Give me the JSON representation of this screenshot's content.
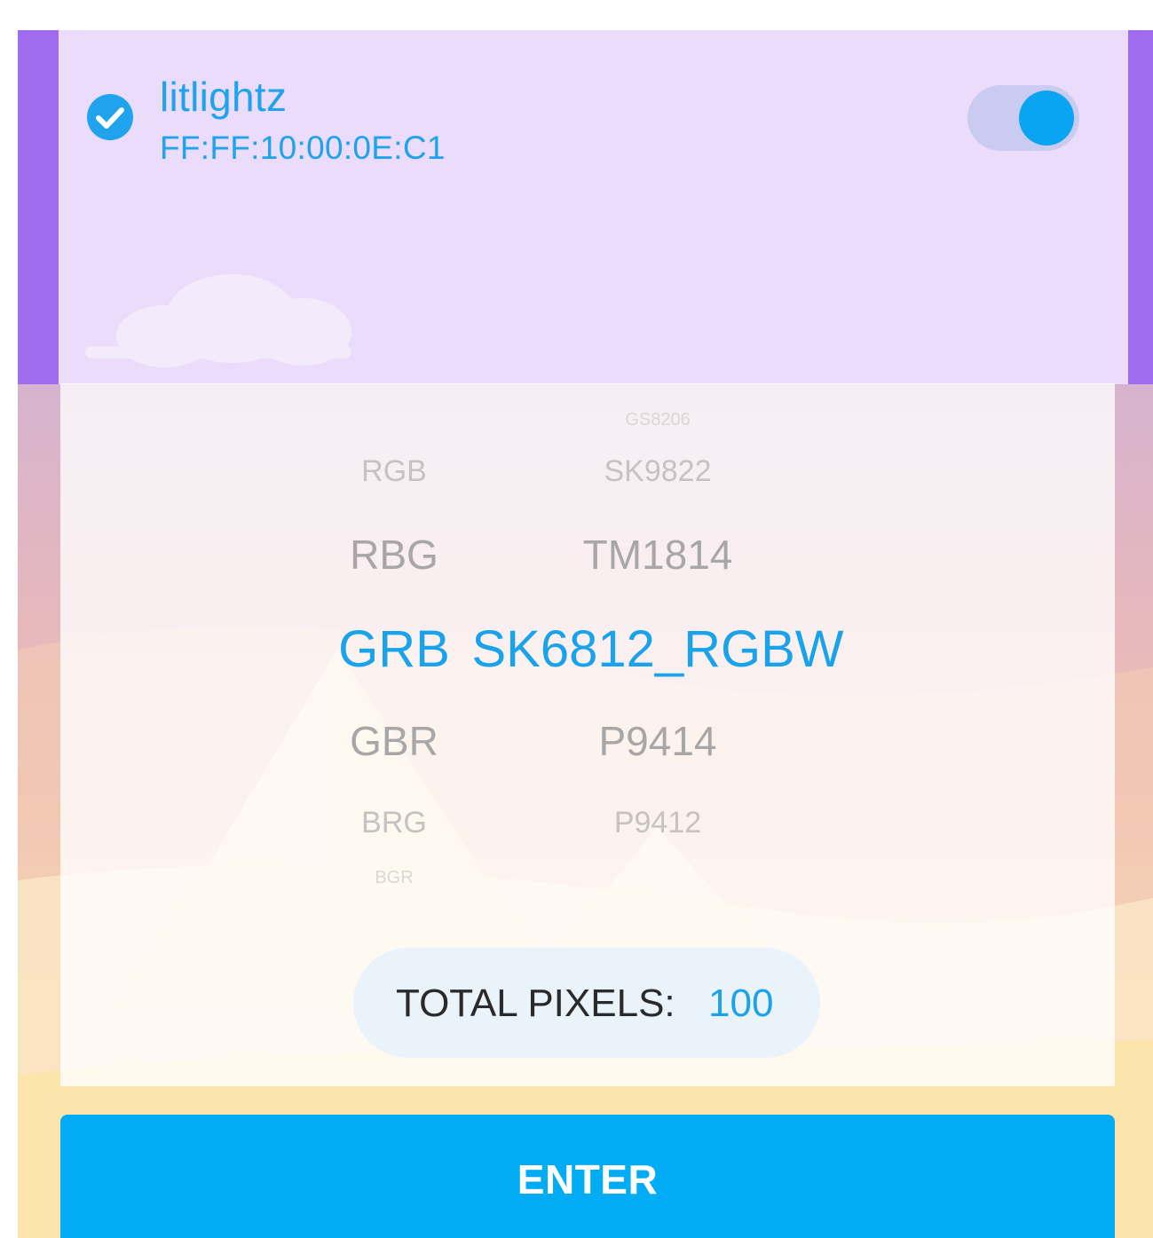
{
  "device": {
    "name": "litlightz",
    "mac": "FF:FF:10:00:0E:C1",
    "connected": true,
    "power_on": true
  },
  "picker": {
    "color_order": {
      "options": [
        "RGB",
        "RBG",
        "GRB",
        "GBR",
        "BRG",
        "BGR"
      ],
      "selected": "GRB"
    },
    "chip_type": {
      "options": [
        "GS8206",
        "SK9822",
        "TM1814",
        "SK6812_RGBW",
        "P9414",
        "P9412"
      ],
      "selected": "SK6812_RGBW"
    }
  },
  "total_pixels": {
    "label": "TOTAL PIXELS:",
    "value": "100"
  },
  "enter_button": {
    "label": "ENTER"
  },
  "colors": {
    "accent": "#1aa3ea",
    "header_border": "#a06cef",
    "header_bg": "#ecdcfb",
    "button_bg": "#02acf5"
  },
  "icons": {
    "connected": "check-circle-icon",
    "power": "toggle-switch"
  }
}
